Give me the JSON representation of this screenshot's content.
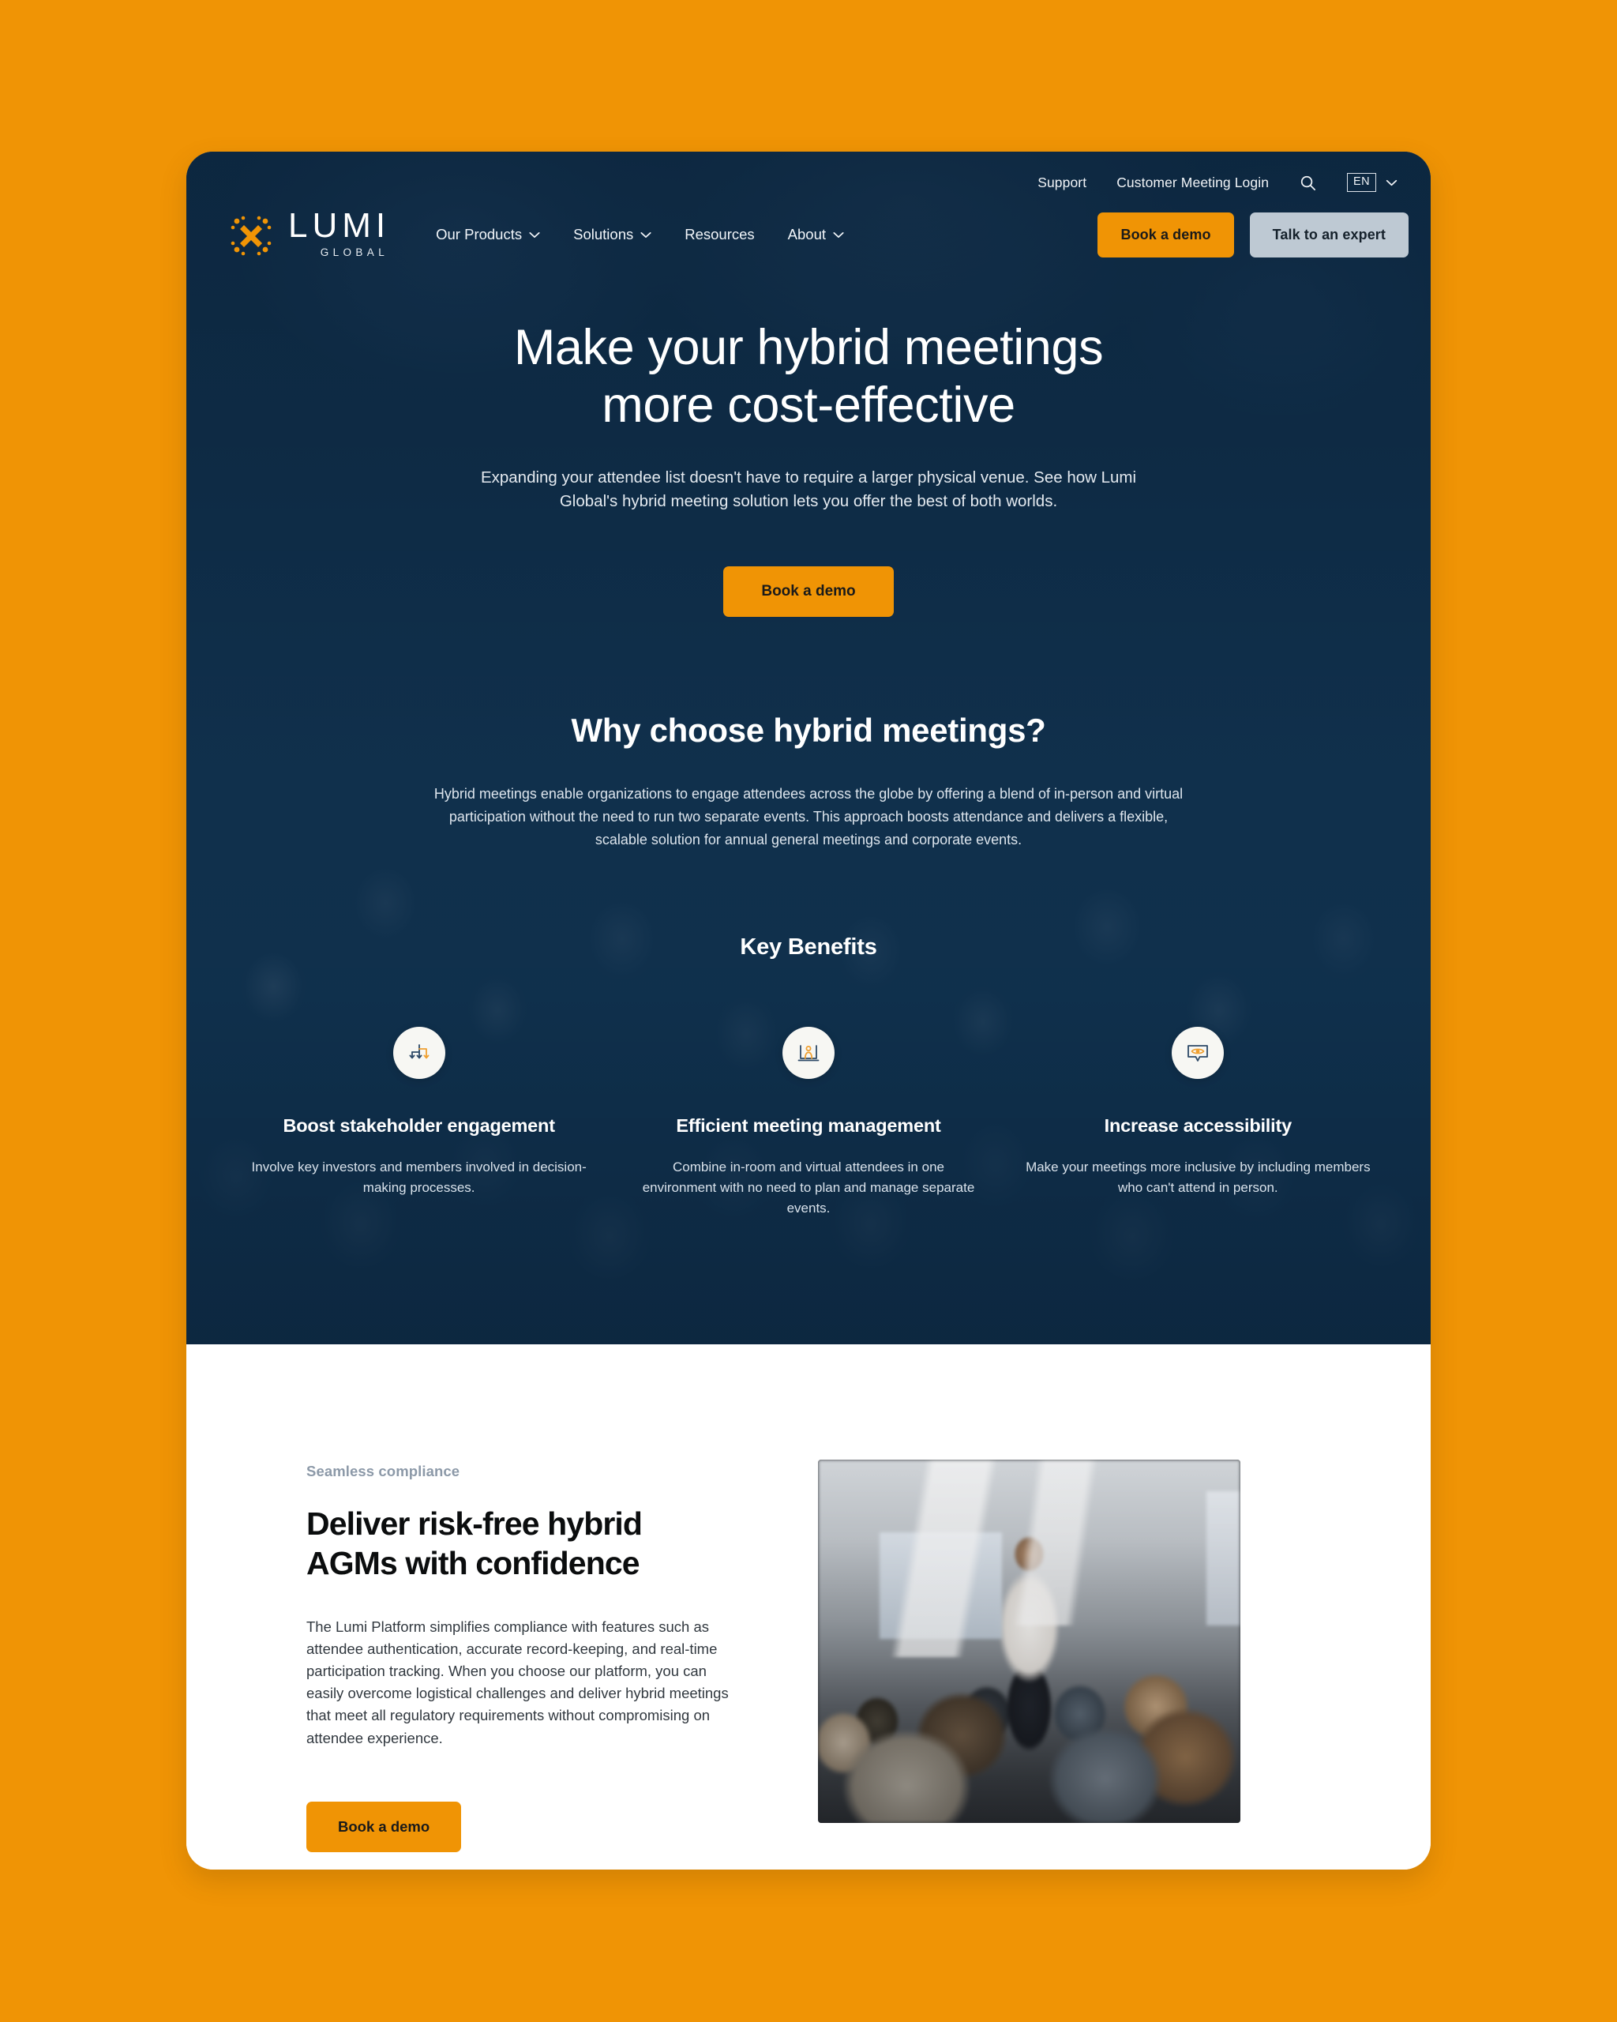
{
  "colors": {
    "page_background": "#F09405",
    "accent_orange": "#F09405",
    "hero_navy": "#0E2C4B",
    "button_light": "#BEC9D3",
    "eyebrow_gray": "#8C99A8"
  },
  "utility_bar": {
    "support_label": "Support",
    "customer_login_label": "Customer Meeting Login",
    "search_icon": "search-icon",
    "language_code": "EN",
    "language_chevron": "chevron-down-icon"
  },
  "brand": {
    "name": "LUMI",
    "tagline": "GLOBAL",
    "logo_icon": "lumi-x-logo-icon"
  },
  "nav": {
    "items": [
      {
        "label": "Our Products",
        "has_dropdown": true
      },
      {
        "label": "Solutions",
        "has_dropdown": true
      },
      {
        "label": "Resources",
        "has_dropdown": false
      },
      {
        "label": "About",
        "has_dropdown": true
      }
    ],
    "cta_primary": "Book a demo",
    "cta_secondary": "Talk to an expert"
  },
  "hero": {
    "title_line1": "Make your hybrid meetings",
    "title_line2": "more cost-effective",
    "subtitle": "Expanding your attendee list doesn't have to require a larger physical venue. See how Lumi Global's hybrid meeting solution lets you offer the best of both worlds.",
    "cta": "Book a demo"
  },
  "why": {
    "title": "Why choose hybrid meetings?",
    "body": "Hybrid meetings enable organizations to engage attendees across the globe by offering a blend of in-person and virtual participation without the need to run two separate events. This approach boosts attendance and delivers a flexible, scalable solution for annual general meetings and corporate events."
  },
  "key_benefits": {
    "title": "Key Benefits",
    "items": [
      {
        "icon": "branching-arrows-icon",
        "heading": "Boost stakeholder engagement",
        "body": "Involve key investors and members involved in decision-making processes."
      },
      {
        "icon": "presenter-laptop-icon",
        "heading": "Efficient meeting management",
        "body": "Combine in-room and virtual attendees in one environment with no need to plan and manage separate events."
      },
      {
        "icon": "eye-speech-bubble-icon",
        "heading": "Increase accessibility",
        "body": "Make your meetings more inclusive by including members who can't attend in person."
      }
    ]
  },
  "compliance": {
    "eyebrow": "Seamless compliance",
    "title_line1": "Deliver risk-free hybrid",
    "title_line2": "AGMs with confidence",
    "body": "The Lumi Platform simplifies compliance with features such as attendee authentication, accurate record-keeping, and real-time participation tracking. When you choose our platform, you can easily overcome logistical challenges and deliver hybrid meetings that meet all regulatory requirements without compromising on attendee experience.",
    "cta": "Book a demo",
    "image_alt": "conference-room-presentation-photo"
  }
}
